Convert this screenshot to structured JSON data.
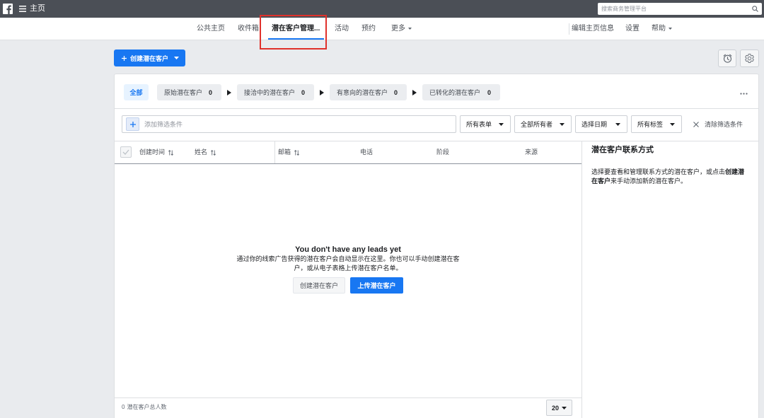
{
  "colors": {
    "topbar_bg": "#4b4f56",
    "page_bg": "#e9ebee",
    "accent": "#1877f2",
    "annotation": "#e0312b"
  },
  "topbar": {
    "logo_icon": "facebook-logo-icon",
    "menu_icon": "hamburger-menu-icon",
    "title": "主页",
    "search": {
      "placeholder": "搜索商务管理平台",
      "value": "",
      "icon": "search-icon"
    }
  },
  "nav": {
    "tabs": [
      {
        "label": "公共主页",
        "active": false
      },
      {
        "label": "收件箱",
        "active": false
      },
      {
        "label": "潜在客户管理...",
        "active": true
      },
      {
        "label": "活动",
        "active": false
      },
      {
        "label": "预约",
        "active": false
      },
      {
        "label": "更多",
        "active": false,
        "icon": "caret-down-icon"
      }
    ],
    "right": [
      {
        "label": "编辑主页信息"
      },
      {
        "label": "设置"
      },
      {
        "label": "帮助",
        "icon": "caret-down-icon"
      }
    ]
  },
  "toolbar": {
    "create_button": {
      "label": "创建潜在客户",
      "icon": "plus-icon",
      "caret": "caret-down-icon"
    },
    "history_icon": "clock-icon",
    "settings_icon": "gear-icon"
  },
  "pipeline": {
    "all_label": "全部",
    "stages": [
      {
        "label": "原始潜在客户",
        "count": "0"
      },
      {
        "label": "接洽中的潜在客户",
        "count": "0"
      },
      {
        "label": "有意向的潜在客户",
        "count": "0"
      },
      {
        "label": "已转化的潜在客户",
        "count": "0"
      }
    ],
    "separator_icon": "arrow-right-icon",
    "more_icon": "more-options-icon"
  },
  "filters": {
    "add_filter": {
      "placeholder": "添加筛选条件",
      "value": "",
      "icon": "plus-icon"
    },
    "dropdowns": [
      {
        "label": "所有表单"
      },
      {
        "label": "全部所有者"
      },
      {
        "label": "选择日期"
      },
      {
        "label": "所有标签"
      }
    ],
    "clear_label": "清除筛选条件",
    "clear_icon": "close-icon"
  },
  "table": {
    "columns": [
      {
        "label": "创建时间",
        "sortable": true
      },
      {
        "label": "姓名",
        "sortable": true
      },
      {
        "label": "邮箱",
        "sortable": true
      },
      {
        "label": "电话",
        "sortable": false
      },
      {
        "label": "阶段",
        "sortable": false
      },
      {
        "label": "来源",
        "sortable": false
      }
    ],
    "rows": [],
    "empty_state": {
      "title": "You don't have any leads yet",
      "description": "通过你的线索广告获得的潜在客户会自动显示在这里。你也可以手动创建潜在客户，或从电子表格上传潜在客户名单。",
      "create_button": "创建潜在客户",
      "upload_button": "上传潜在客户"
    },
    "footer": {
      "total_count": "0",
      "total_label": "潜在客户总人数",
      "page_size": "20"
    }
  },
  "side_panel": {
    "title": "潜在客户联系方式",
    "description_before": "选择要查看和管理联系方式的潜在客户，或点击",
    "description_bold": "创建潜在客户",
    "description_after": "来手动添加新的潜在客户。"
  }
}
